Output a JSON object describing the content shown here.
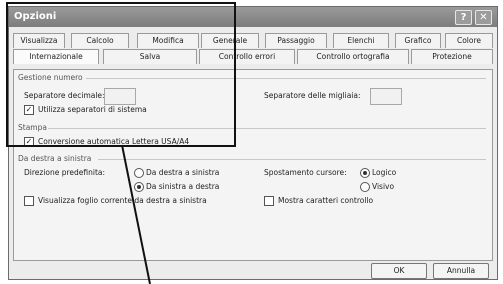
{
  "window": {
    "title": "Opzioni",
    "help_glyph": "?",
    "close_glyph": "✕"
  },
  "tabs_row1": [
    "Visualizza",
    "Calcolo",
    "Modifica",
    "Generale",
    "Passaggio",
    "Elenchi",
    "Grafico",
    "Colore"
  ],
  "tabs_row2": [
    "Internazionale",
    "Salva",
    "Controllo errori",
    "Controllo ortografia",
    "Protezione"
  ],
  "numbers": {
    "section": "Gestione numero",
    "decimal_label": "Separatore decimale:",
    "decimal_value": "",
    "thousands_label": "Separatore delle migliaia:",
    "thousands_value": "",
    "use_system_label": "Utilizza separatori di sistema"
  },
  "print": {
    "section": "Stampa",
    "a4_label": "Conversione automatica Lettera USA/A4"
  },
  "rtl": {
    "section": "Da destra a sinistra",
    "default_dir_label": "Direzione predefinita:",
    "dir_rtl": "Da destra a sinistra",
    "dir_ltr": "Da sinistra a destra",
    "cursor_label": "Spostamento cursore:",
    "cursor_logic": "Logico",
    "cursor_visual": "Visivo",
    "view_sheet_label": "Visualizza foglio corrente da destra a sinistra",
    "show_ctrl_label": "Mostra caratteri controllo"
  },
  "buttons": {
    "ok": "OK",
    "cancel": "Annulla"
  }
}
